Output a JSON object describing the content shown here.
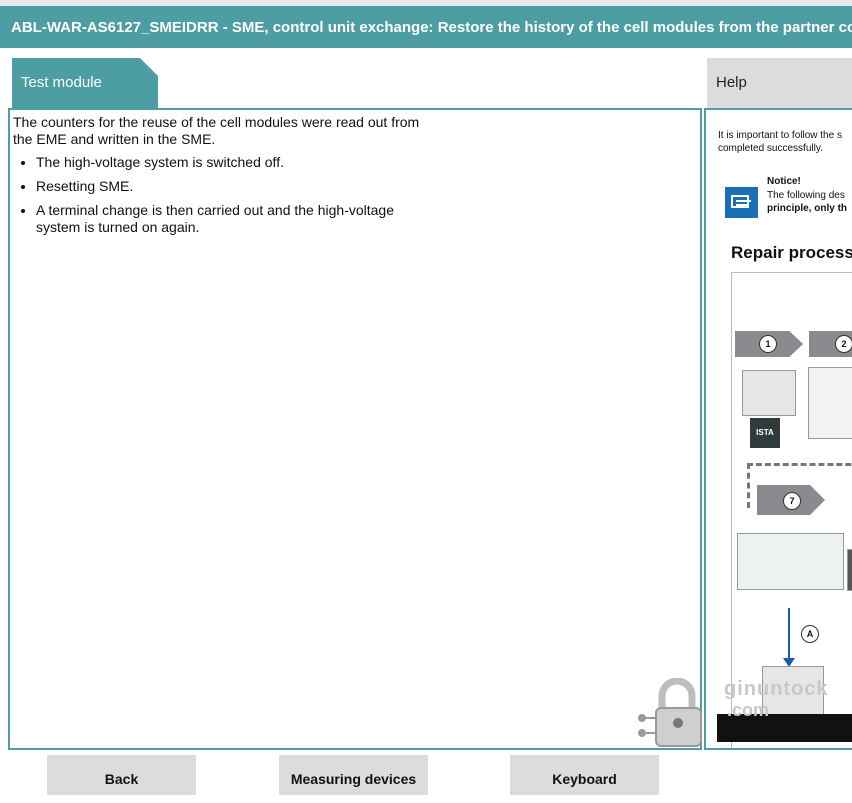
{
  "window": {
    "title": "ABL-WAR-AS6127_SMEIDRR - SME, control unit exchange: Restore the history of the cell modules from the partner control unit"
  },
  "tabs": {
    "test_module": "Test module",
    "help": "Help"
  },
  "main": {
    "intro": "The counters for the reuse of the cell modules were read out from the EME and written in the SME.",
    "bullets": [
      "The high-voltage system is switched off.",
      "Resetting SME.",
      "A terminal change is then carried out and the high-voltage system is turned on again."
    ]
  },
  "help": {
    "intro_line1": "It is important to follow the s",
    "intro_line2": "completed successfully.",
    "notice_title": "Notice!",
    "notice_line1": "The following des",
    "notice_line2": "principle, only th",
    "repair_title": "Repair process",
    "diagram": {
      "step_1": "1",
      "step_2": "2",
      "step_7": "7",
      "step_a": "A",
      "ista_label": "ISTA"
    }
  },
  "watermark": {
    "line1": "ginuntock",
    "line2": ".com"
  },
  "footer": {
    "back": "Back",
    "measuring_devices": "Measuring devices",
    "keyboard": "Keyboard"
  },
  "colors": {
    "accent": "#4d9ea2",
    "button_bg": "#dcdcdc",
    "notice_blue": "#1a6fb5"
  }
}
